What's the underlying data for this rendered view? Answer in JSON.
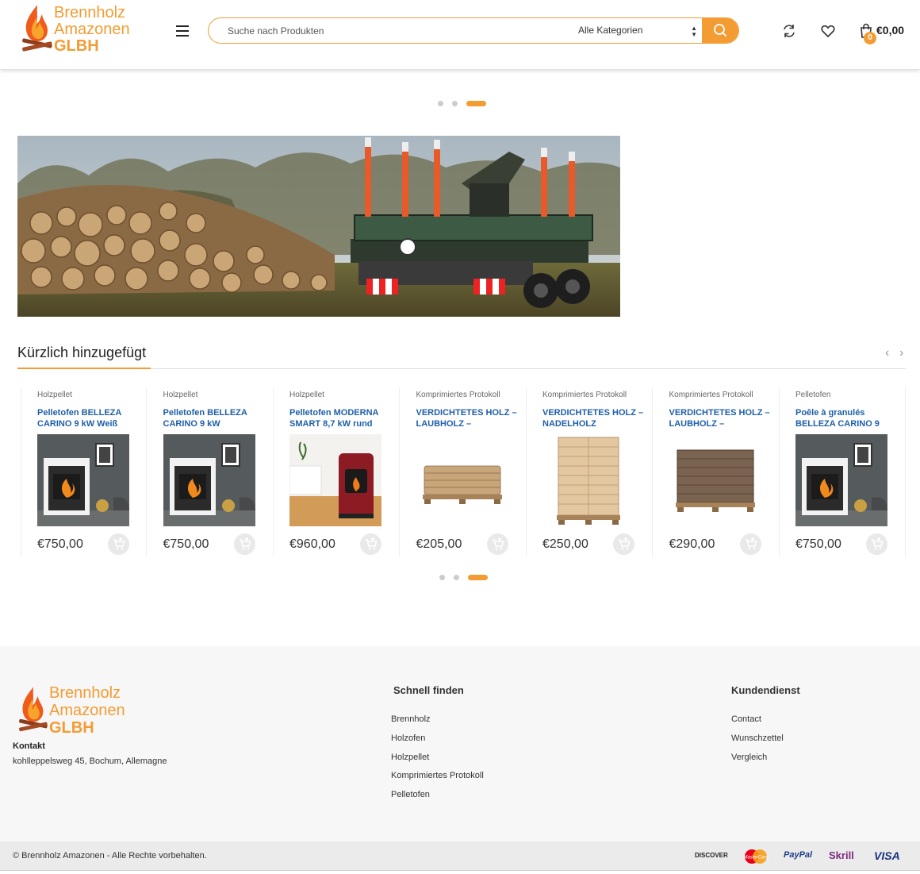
{
  "header": {
    "logo_line1": "Brennholz",
    "logo_line2": "Amazonen",
    "logo_line3": "GLBH",
    "search_placeholder": "Suche nach Produkten",
    "category_selected": "Alle Kategorien",
    "cart_count": "0",
    "cart_total": "€0,00"
  },
  "slider": {
    "dot_count": 3,
    "active_index": 2
  },
  "section": {
    "title": "Kürzlich hinzugefügt"
  },
  "products": [
    {
      "category": "Holzpellet",
      "title": "Pelletofen BELLEZA CARINO 9 kW Weiß",
      "price": "€750,00",
      "image": "stove-white"
    },
    {
      "category": "Holzpellet",
      "title": "Pelletofen BELLEZA CARINO 9 kW",
      "price": "€750,00",
      "image": "stove-white"
    },
    {
      "category": "Holzpellet",
      "title": "Pelletofen MODERNA SMART 8,7 kW rund",
      "price": "€960,00",
      "image": "stove-red"
    },
    {
      "category": "Komprimiertes Protokoll",
      "title": "VERDICHTETES HOLZ – LAUBHOLZ –",
      "price": "€205,00",
      "image": "pallet-low"
    },
    {
      "category": "Komprimiertes Protokoll",
      "title": "VERDICHTETES HOLZ – NADELHOLZ",
      "price": "€250,00",
      "image": "pallet-tall"
    },
    {
      "category": "Komprimiertes Protokoll",
      "title": "VERDICHTETES HOLZ – LAUBHOLZ –",
      "price": "€290,00",
      "image": "pallet-dark"
    },
    {
      "category": "Pelletofen",
      "title": "Poêle à granulés BELLEZA CARINO 9",
      "price": "€750,00",
      "image": "stove-white"
    }
  ],
  "footer": {
    "logo_line1": "Brennholz",
    "logo_line2": "Amazonen",
    "logo_line3": "GLBH",
    "contact_title": "Kontakt",
    "contact_address": "kohlleppelsweg 45, Bochum, Allemagne",
    "quick_title": "Schnell finden",
    "quick_links": [
      "Brennholz",
      "Holzofen",
      "Holzpellet",
      "Komprimiertes Protokoll",
      "Pelletofen"
    ],
    "service_title": "Kundendienst",
    "service_links": [
      "Contact",
      "Wunschzettel",
      "Vergleich"
    ],
    "copyright": "© Brennholz Amazonen - Alle Rechte vorbehalten.",
    "payments": [
      "DISCOVER",
      "MasterCard",
      "PayPal",
      "Skrill",
      "VISA"
    ]
  },
  "colors": {
    "accent": "#f39c33",
    "link": "#1e5fa8"
  }
}
